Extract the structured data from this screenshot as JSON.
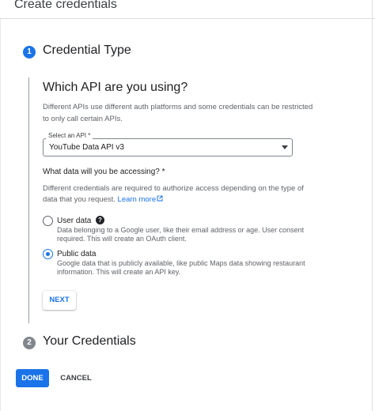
{
  "header": {
    "title": "Create credentials"
  },
  "steps": [
    {
      "number": "1",
      "title": "Credential Type",
      "state": "active",
      "color": "#1a73e8"
    },
    {
      "number": "2",
      "title": "Your Credentials",
      "state": "inactive",
      "color": "#80868b"
    }
  ],
  "credential_type": {
    "heading": "Which API are you using?",
    "description_lines": [
      "Different APIs use different auth platforms and some credentials can be restricted",
      "to only call certain APIs."
    ],
    "api_select": {
      "label": "Select an API *",
      "value": "YouTube Data API v3"
    },
    "data_question": "What data will you be accessing? *",
    "data_description_lines": [
      "Different credentials are required to authorize access depending on the type of",
      "data that you request."
    ],
    "learn_more": "Learn more",
    "options": [
      {
        "label": "User data",
        "checked": false,
        "description_lines": [
          "Data belonging to a Google user, like their email address or age. User consent",
          "required. This will create an OAuth client."
        ]
      },
      {
        "label": "Public data",
        "checked": true,
        "description_lines": [
          "Google data that is publicly available, like public Maps data showing restaurant",
          "information. This will create an API key."
        ]
      }
    ],
    "next_label": "NEXT"
  },
  "actions": {
    "done_label": "DONE",
    "cancel_label": "CANCEL"
  },
  "colors": {
    "accent": "#1a73e8",
    "text_secondary": "#5f6368"
  }
}
